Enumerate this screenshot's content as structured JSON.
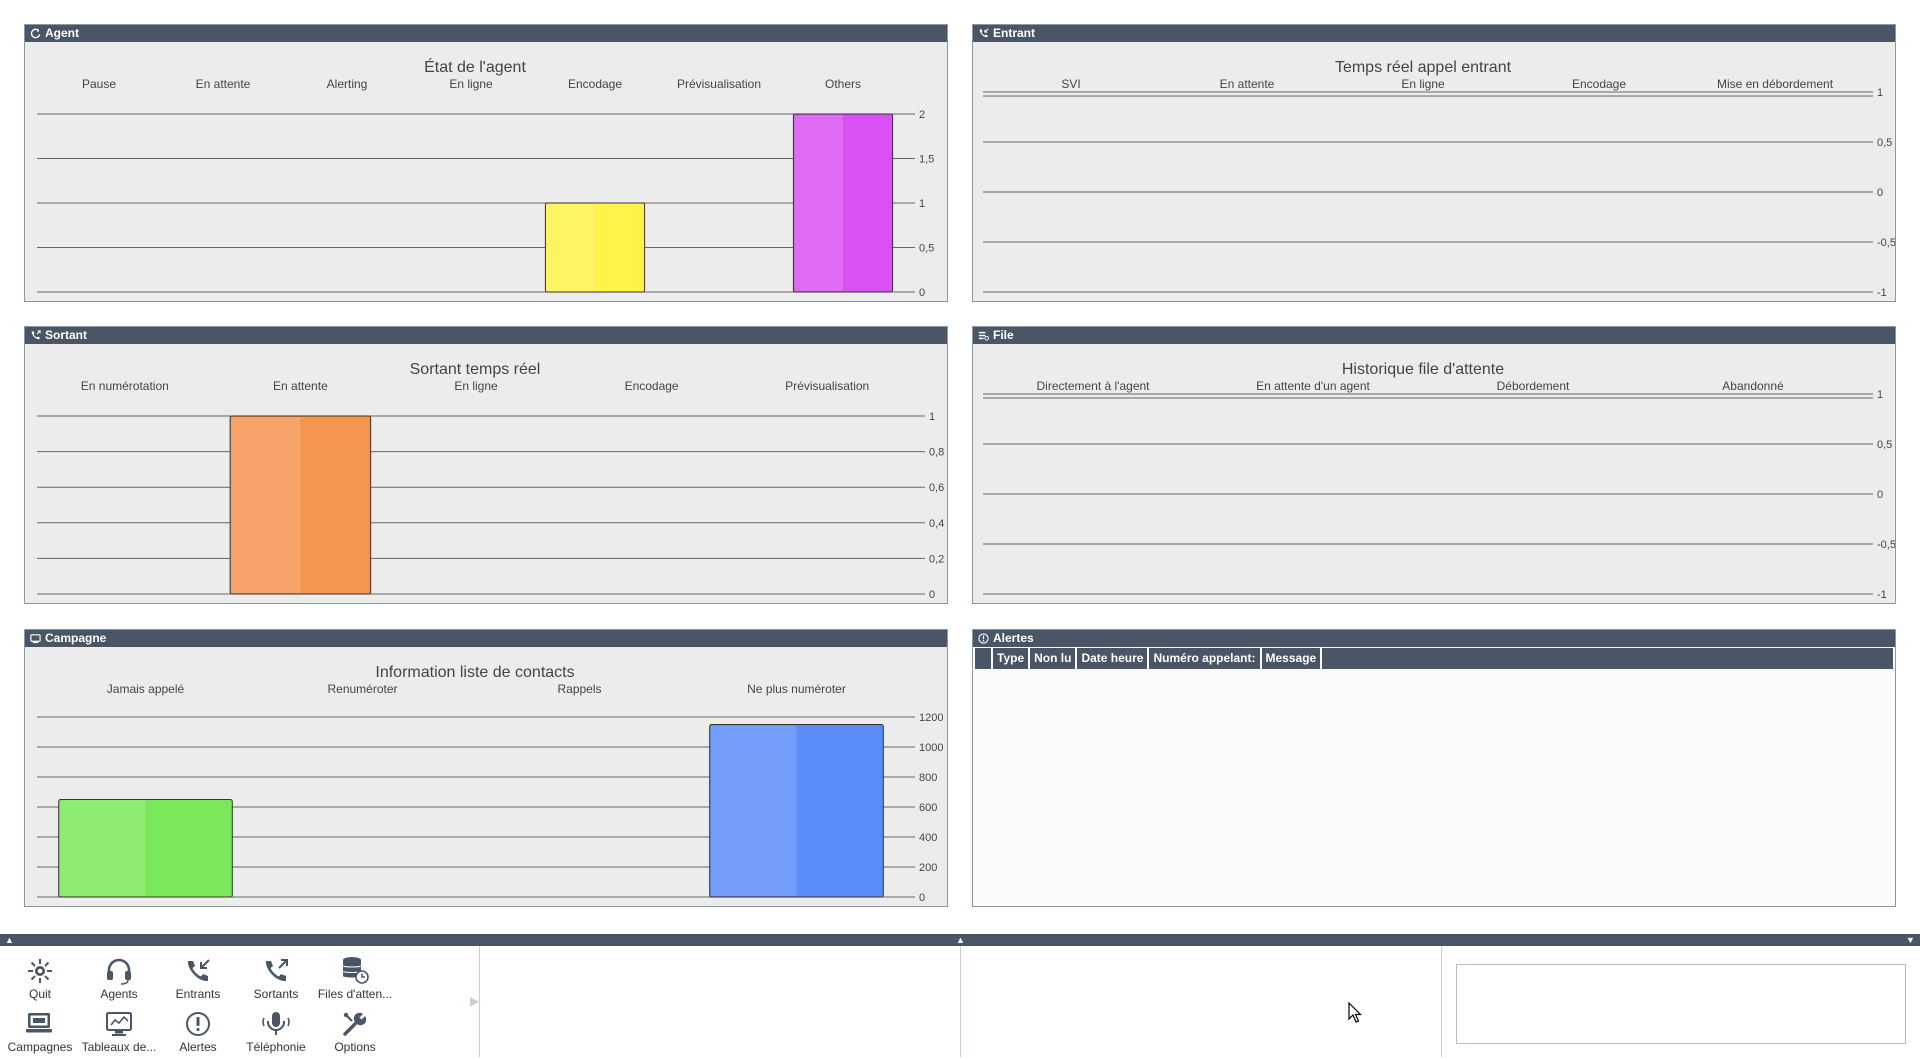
{
  "panels": {
    "agent": {
      "header": "Agent",
      "chart_data": {
        "type": "bar",
        "title": "État de l'agent",
        "categories": [
          "Pause",
          "En attente",
          "Alerting",
          "En ligne",
          "Encodage",
          "Prévisualisation",
          "Others"
        ],
        "values": [
          0,
          0,
          0,
          0,
          1,
          0,
          2
        ],
        "colors": [
          "#f5a25e",
          "#f5a25e",
          "#f5a25e",
          "#f5a25e",
          "#fff34a",
          "#f5a25e",
          "#d950f2"
        ],
        "ylim": [
          0,
          2
        ],
        "yticks": [
          "0",
          "0,5",
          "1",
          "1,5",
          "2"
        ]
      }
    },
    "entrant": {
      "header": "Entrant",
      "chart_data": {
        "type": "bar",
        "title": "Temps réel appel entrant",
        "categories": [
          "SVI",
          "En attente",
          "En ligne",
          "Encodage",
          "Mise en débordement"
        ],
        "values": [
          0,
          0,
          0,
          0,
          0
        ],
        "ylim": [
          -1,
          1
        ],
        "yticks": [
          "-1",
          "-0,5",
          "0",
          "0,5",
          "1"
        ]
      }
    },
    "sortant": {
      "header": "Sortant",
      "chart_data": {
        "type": "bar",
        "title": "Sortant temps réel",
        "categories": [
          "En numérotation",
          "En attente",
          "En ligne",
          "Encodage",
          "Prévisualisation"
        ],
        "values": [
          0,
          1,
          0,
          0,
          0
        ],
        "colors": [
          "#f59450",
          "#f59450",
          "#f59450",
          "#f59450",
          "#f59450"
        ],
        "ylim": [
          0,
          1
        ],
        "yticks": [
          "0",
          "0,2",
          "0,4",
          "0,6",
          "0,8",
          "1"
        ]
      }
    },
    "file": {
      "header": "File",
      "chart_data": {
        "type": "bar",
        "title": "Historique file d'attente",
        "categories": [
          "Directement à l'agent",
          "En attente d'un agent",
          "Débordement",
          "Abandonné"
        ],
        "values": [
          0,
          0,
          0,
          0
        ],
        "ylim": [
          -1,
          1
        ],
        "yticks": [
          "-1",
          "-0,5",
          "0",
          "0,5",
          "1"
        ]
      }
    },
    "campagne": {
      "header": "Campagne",
      "chart_data": {
        "type": "bar",
        "title": "Information liste de contacts",
        "categories": [
          "Jamais appelé",
          "Renuméroter",
          "Rappels",
          "Ne plus numéroter"
        ],
        "values": [
          650,
          0,
          0,
          1150
        ],
        "colors": [
          "#7be85a",
          "#7be85a",
          "#7be85a",
          "#5b8cf7"
        ],
        "ylim": [
          0,
          1200
        ],
        "yticks": [
          "0",
          "200",
          "400",
          "600",
          "800",
          "1000",
          "1200"
        ]
      }
    },
    "alertes": {
      "header": "Alertes",
      "columns": [
        "Type",
        "Non lu",
        "Date heure",
        "Numéro appelant:",
        "Message"
      ]
    }
  },
  "toolbar": {
    "items": [
      {
        "label": "Quit",
        "icon": "quit-icon"
      },
      {
        "label": "Agents",
        "icon": "headset-icon"
      },
      {
        "label": "Entrants",
        "icon": "incoming-call-icon"
      },
      {
        "label": "Sortants",
        "icon": "outgoing-call-icon"
      },
      {
        "label": "Files d'atten...",
        "icon": "queue-database-icon"
      },
      {
        "label": "Campagnes",
        "icon": "campaign-monitor-icon"
      },
      {
        "label": "Tableaux de...",
        "icon": "dashboard-icon"
      },
      {
        "label": "Alertes",
        "icon": "alert-icon"
      },
      {
        "label": "Téléphonie",
        "icon": "microphone-icon"
      },
      {
        "label": "Options",
        "icon": "tools-icon"
      }
    ]
  }
}
